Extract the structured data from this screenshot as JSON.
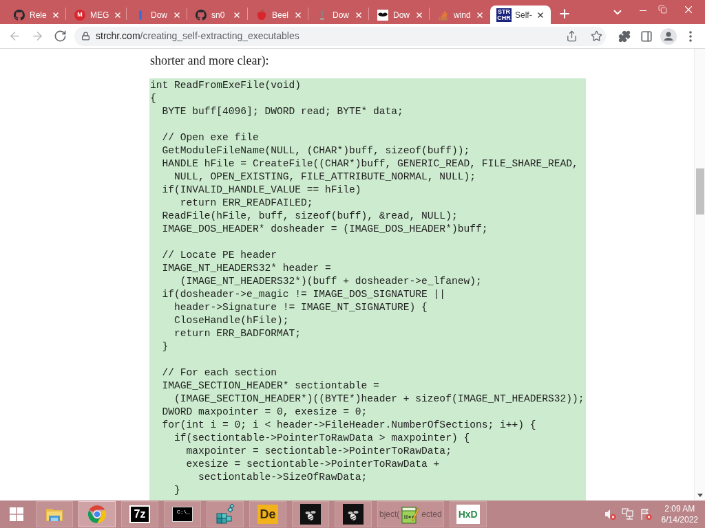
{
  "tabs": [
    {
      "title": "Rele",
      "kind": "github",
      "selected": false
    },
    {
      "title": "MEG",
      "kind": "mega",
      "glyph": "M",
      "selected": false
    },
    {
      "title": "Dow",
      "kind": "bar",
      "selected": false
    },
    {
      "title": "sn0",
      "kind": "github",
      "selected": false
    },
    {
      "title": "Beel",
      "kind": "apple",
      "selected": false
    },
    {
      "title": "Dow",
      "kind": "pin",
      "selected": false
    },
    {
      "title": "Dow",
      "kind": "lips",
      "selected": false
    },
    {
      "title": "wind",
      "kind": "stack",
      "selected": false
    },
    {
      "title": "Self-",
      "kind": "site",
      "glyph_lines": [
        "STR",
        "CHR"
      ],
      "selected": true
    }
  ],
  "toolbar": {
    "nav": [
      {
        "kind": "back",
        "disabled": true
      },
      {
        "kind": "forward",
        "disabled": true
      },
      {
        "kind": "reload",
        "disabled": false
      }
    ],
    "url": {
      "host": "strchr.com",
      "path": "/creating_self-extracting_executables"
    }
  },
  "page": {
    "intro": "shorter and more clear):",
    "code": "int ReadFromExeFile(void)\n{\n  BYTE buff[4096]; DWORD read; BYTE* data;\n\n  // Open exe file\n  GetModuleFileName(NULL, (CHAR*)buff, sizeof(buff));\n  HANDLE hFile = CreateFile((CHAR*)buff, GENERIC_READ, FILE_SHARE_READ,\n    NULL, OPEN_EXISTING, FILE_ATTRIBUTE_NORMAL, NULL);\n  if(INVALID_HANDLE_VALUE == hFile)\n     return ERR_READFAILED;\n  ReadFile(hFile, buff, sizeof(buff), &read, NULL);\n  IMAGE_DOS_HEADER* dosheader = (IMAGE_DOS_HEADER*)buff;\n\n  // Locate PE header\n  IMAGE_NT_HEADERS32* header =\n     (IMAGE_NT_HEADERS32*)(buff + dosheader->e_lfanew);\n  if(dosheader->e_magic != IMAGE_DOS_SIGNATURE ||\n    header->Signature != IMAGE_NT_SIGNATURE) {\n    CloseHandle(hFile);\n    return ERR_BADFORMAT;\n  }\n\n  // For each section\n  IMAGE_SECTION_HEADER* sectiontable =\n    (IMAGE_SECTION_HEADER*)((BYTE*)header + sizeof(IMAGE_NT_HEADERS32));\n  DWORD maxpointer = 0, exesize = 0;\n  for(int i = 0; i < header->FileHeader.NumberOfSections; i++) {\n    if(sectiontable->PointerToRawData > maxpointer) {\n      maxpointer = sectiontable->PointerToRawData;\n      exesize = sectiontable->PointerToRawData +\n        sectiontable->SizeOfRawData;\n    }"
  },
  "taskbar": {
    "apps": [
      {
        "kind": "explorer",
        "selected": false
      },
      {
        "kind": "chrome",
        "selected": true
      },
      {
        "kind": "sevenzip",
        "glyph": "7z",
        "selected": false
      },
      {
        "kind": "cmd",
        "glyph": "C:\\_",
        "selected": false
      },
      {
        "kind": "regedit",
        "selected": false
      },
      {
        "kind": "de",
        "glyph": "De",
        "selected": false
      },
      {
        "kind": "bee",
        "selected": false
      },
      {
        "kind": "bee",
        "selected": false
      },
      {
        "kind": "npp",
        "label_before": "bject(",
        "label_after": "ected",
        "selected": false
      },
      {
        "kind": "hxd",
        "glyph": "HxD",
        "selected": false
      }
    ],
    "tray": [
      {
        "kind": "volume",
        "muted": true
      },
      {
        "kind": "network"
      },
      {
        "kind": "flag",
        "alert": true
      }
    ],
    "clock": {
      "time": "2:09 AM",
      "date": "6/14/2022"
    }
  }
}
